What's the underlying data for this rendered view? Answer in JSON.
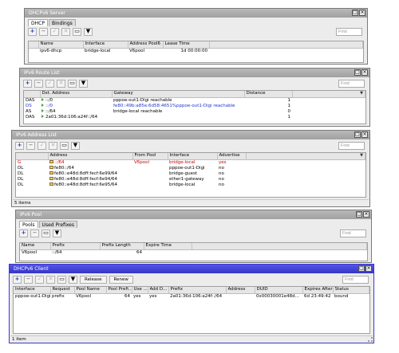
{
  "server": {
    "title": "DHCPv6 Server",
    "tabs": [
      "DHCP",
      "Bindings"
    ],
    "find_placeholder": "Find",
    "columns": [
      "",
      "Name",
      "Interface",
      "Address Pool6",
      "Lease Time"
    ],
    "rows": [
      {
        "flag": "",
        "name": "ipv6-dhcp",
        "interface": "bridge-local",
        "pool": "V6pool",
        "lease": "1d 00:00:00"
      }
    ]
  },
  "routes": {
    "title": "IPv6 Route List",
    "find_placeholder": "Find",
    "columns": [
      "",
      "Dst. Address",
      "Gateway",
      "Distance"
    ],
    "rows": [
      {
        "flag": "DAS",
        "dst": "::/0",
        "gateway": "pppoe-out1-Digi reachable",
        "distance": "1",
        "color": "normal"
      },
      {
        "flag": "DS",
        "dst": "::/0",
        "gateway": "fe80::49b:a85e:6d58:4651%pppoe-out1-Digi reachable",
        "distance": "1",
        "color": "blue"
      },
      {
        "flag": "AS",
        "dst": "::/64",
        "gateway": "bridge-local reachable",
        "distance": "0",
        "color": "normal"
      },
      {
        "flag": "DAS",
        "dst": "2a01:36d:106:a24f::/64",
        "gateway": "",
        "distance": "1",
        "color": "normal"
      }
    ]
  },
  "addresses": {
    "title": "IPv6 Address List",
    "find_placeholder": "Find",
    "columns": [
      "",
      "Address",
      "From Pool",
      "Interface",
      "Advertise"
    ],
    "rows": [
      {
        "flag": "G",
        "address": "::/64",
        "from_pool": "V6pool",
        "interface": "bridge-local",
        "advertise": "yes",
        "color": "red"
      },
      {
        "flag": "DL",
        "address": "fe80::/64",
        "from_pool": "",
        "interface": "pppoe-out1-Digi",
        "advertise": "no",
        "color": "normal"
      },
      {
        "flag": "DL",
        "address": "fe80::e48d:8dff:fecf:6e99/64",
        "from_pool": "",
        "interface": "bridge-guest",
        "advertise": "no",
        "color": "normal"
      },
      {
        "flag": "DL",
        "address": "fe80::e48d:8dff:fecf:6e94/64",
        "from_pool": "",
        "interface": "ether1-gateway",
        "advertise": "no",
        "color": "normal"
      },
      {
        "flag": "DL",
        "address": "fe80::e48d:8dff:fecf:6e95/64",
        "from_pool": "",
        "interface": "bridge-local",
        "advertise": "no",
        "color": "normal"
      }
    ],
    "status": "5 items"
  },
  "pool": {
    "title": "IPv6 Pool",
    "tabs": [
      "Pools",
      "Used Prefixes"
    ],
    "find_placeholder": "Find",
    "columns": [
      "Name",
      "Prefix",
      "Prefix Length",
      "Expire Time"
    ],
    "rows": [
      {
        "name": "V6pool",
        "prefix": "::/64",
        "prefix_length": "64",
        "expire": ""
      }
    ]
  },
  "client": {
    "title": "DHCPv6 Client",
    "release_label": "Release",
    "renew_label": "Renew",
    "find_placeholder": "Find",
    "columns": [
      "Interface",
      "Request",
      "Pool Name",
      "Pool Prefi...",
      "Use ...",
      "Add D...",
      "Prefix",
      "Address",
      "DUID",
      "Expires After",
      "Status"
    ],
    "rows": [
      {
        "interface": "pppoe-out1-Digi",
        "request": "prefix",
        "pool_name": "V6pool",
        "pool_prefix": "64",
        "use": "yes",
        "add_d": "yes",
        "prefix": "2a01:36d:106:a24f::/64",
        "address": "",
        "duid": "0x00030001e48d...",
        "expires": "6d 23:49:42",
        "status": "bound"
      }
    ],
    "status": "1 item"
  },
  "colors": {
    "active_title": "#3a3ad0",
    "inactive_title": "#a8a8a8",
    "red_text": "#d00000",
    "blue_text": "#2233cc"
  }
}
